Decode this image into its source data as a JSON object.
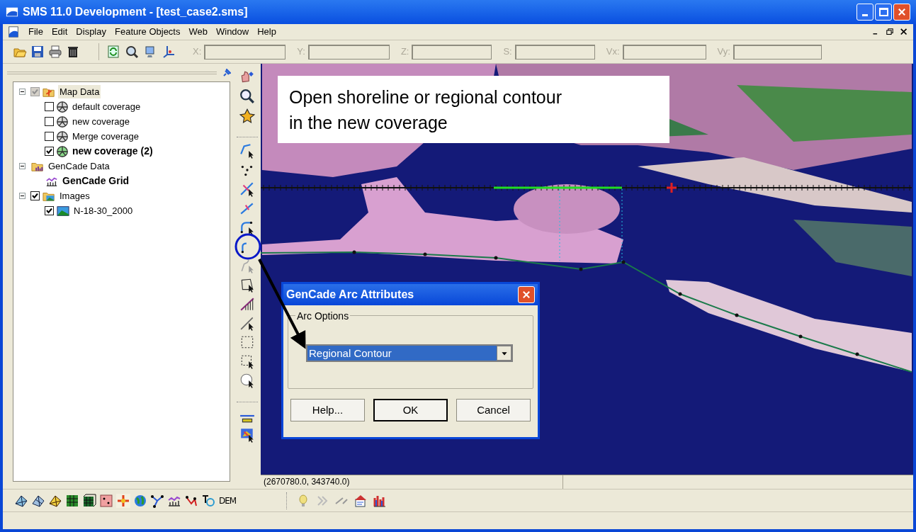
{
  "window": {
    "title": "SMS 11.0 Development - [test_case2.sms]"
  },
  "menu": [
    "File",
    "Edit",
    "Display",
    "Feature Objects",
    "Web",
    "Window",
    "Help"
  ],
  "coordinate_fields": [
    {
      "label": "X:",
      "disabled": true
    },
    {
      "label": "Y:",
      "disabled": true
    },
    {
      "label": "Z:",
      "disabled": true
    },
    {
      "label": "S:",
      "disabled": true
    },
    {
      "label": "Vx:",
      "disabled": true
    },
    {
      "label": "Vy:",
      "disabled": true
    }
  ],
  "tree": [
    {
      "label": "Map Data",
      "kind": "map-folder",
      "checked": true,
      "dimmed": true,
      "expanded": true,
      "selected": true,
      "active": false,
      "children": [
        {
          "label": "default coverage",
          "kind": "coverage",
          "checked": false,
          "selected": false,
          "active": false
        },
        {
          "label": "new coverage",
          "kind": "coverage",
          "checked": false,
          "selected": false,
          "active": false
        },
        {
          "label": "Merge coverage",
          "kind": "coverage",
          "checked": false,
          "selected": false,
          "active": false
        },
        {
          "label": "new coverage (2)",
          "kind": "coverage",
          "checked": true,
          "selected": false,
          "active": true
        }
      ]
    },
    {
      "label": "GenCade Data",
      "kind": "gencade-folder",
      "expanded": true,
      "selected": false,
      "active": false,
      "children": [
        {
          "label": "GenCade Grid",
          "kind": "grid",
          "selected": false,
          "active": true
        }
      ]
    },
    {
      "label": "Images",
      "kind": "image-folder",
      "checked": true,
      "expanded": true,
      "selected": false,
      "active": false,
      "children": [
        {
          "label": "N-18-30_2000",
          "kind": "image",
          "checked": true,
          "selected": false,
          "active": false
        }
      ]
    }
  ],
  "callout": {
    "text": "Open shoreline or regional contour\nin the new coverage"
  },
  "dialog": {
    "title": "GenCade Arc Attributes",
    "group": "Arc Options",
    "dropdown": {
      "value": "Regional Contour"
    },
    "buttons": [
      {
        "label": "Help...",
        "default": false
      },
      {
        "label": "OK",
        "default": true
      },
      {
        "label": "Cancel",
        "default": false
      }
    ]
  },
  "status_bar": {
    "coordinates": "(2670780.0, 343740.0)"
  },
  "module_toolbar": {
    "text_button": "DEM"
  }
}
